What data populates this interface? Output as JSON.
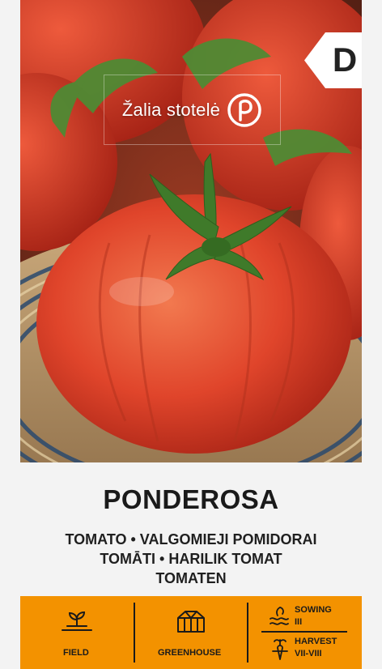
{
  "brand": {
    "name": "Žalia stotelė",
    "logo_icon": "leaf-circle-icon"
  },
  "badge": {
    "letter": "D",
    "color": "#ffffff"
  },
  "product": {
    "title": "PONDEROSA",
    "subtitle_lines": [
      "TOMATO • VALGOMIEJI POMIDORAI",
      "TOMĀTI • HARILIK TOMAT",
      "TOMATEN"
    ]
  },
  "info_bar": {
    "background": "#f39200",
    "field": {
      "label": "FIELD",
      "icon": "sprout-icon"
    },
    "greenhouse": {
      "label": "GREENHOUSE",
      "icon": "greenhouse-icon"
    },
    "sowing": {
      "label": "SOWING",
      "months": "III",
      "icon": "sowing-icon"
    },
    "harvest": {
      "label": "HARVEST",
      "months": "VII-VIII",
      "icon": "harvest-icon"
    }
  }
}
